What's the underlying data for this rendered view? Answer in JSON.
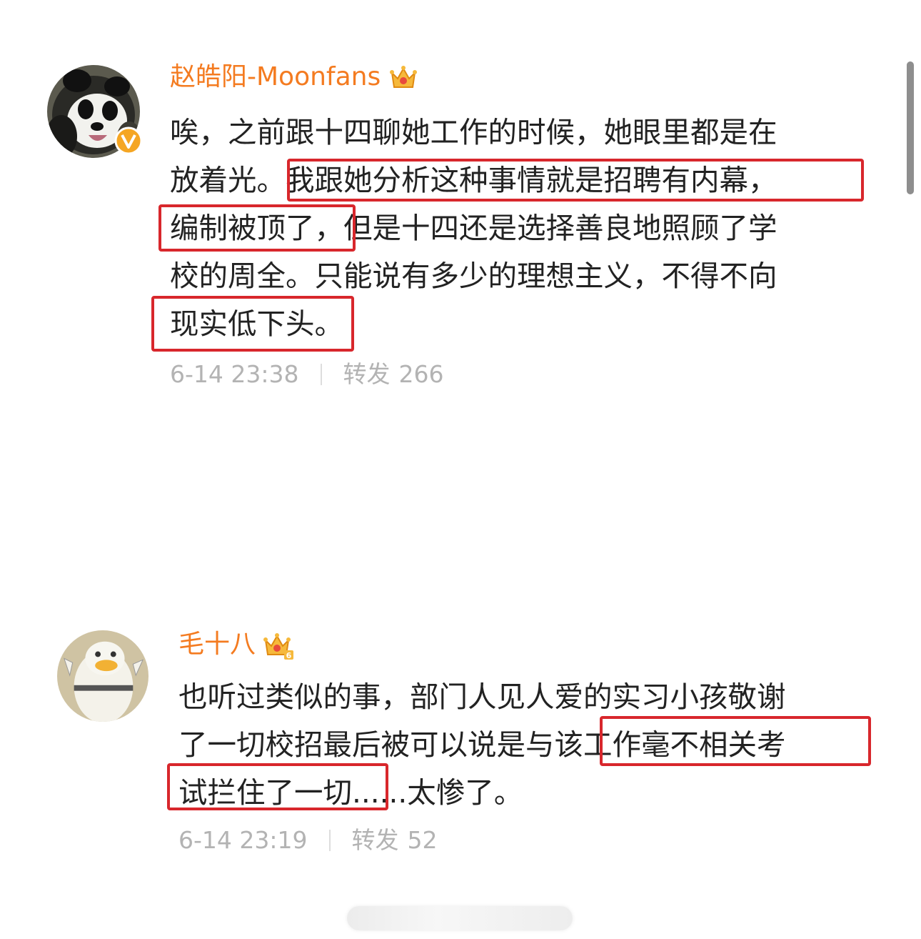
{
  "accent_color": "#f47b20",
  "highlight_color": "#d8272c",
  "meta_color": "#b3b3b3",
  "comments": [
    {
      "username": "赵皓阳-Moonfans",
      "avatar_icon": "panda-avatar-icon",
      "verified_icon": "verified-v-badge-icon",
      "member_icon": "gold-crown-icon",
      "lines": [
        "唉，之前跟十四聊她工作的时候，她眼里都是在",
        "放着光。我跟她分析这种事情就是招聘有内幕，",
        "编制被顶了，但是十四还是选择善良地照顾了学",
        "校的周全。只能说有多少的理想主义，不得不向",
        "现实低下头。"
      ],
      "time": "6-14 23:38",
      "repost_label": "转发",
      "repost_count": "266"
    },
    {
      "username": "毛十八",
      "avatar_icon": "duck-avatar-icon",
      "member_icon": "gold-crown-level-6-icon",
      "lines": [
        "也听过类似的事，部门人见人爱的实习小孩敬谢",
        "了一切校招最后被可以说是与该工作毫不相关考",
        "试拦住了一切......太惨了。"
      ],
      "time": "6-14 23:19",
      "repost_label": "转发",
      "repost_count": "52"
    }
  ]
}
